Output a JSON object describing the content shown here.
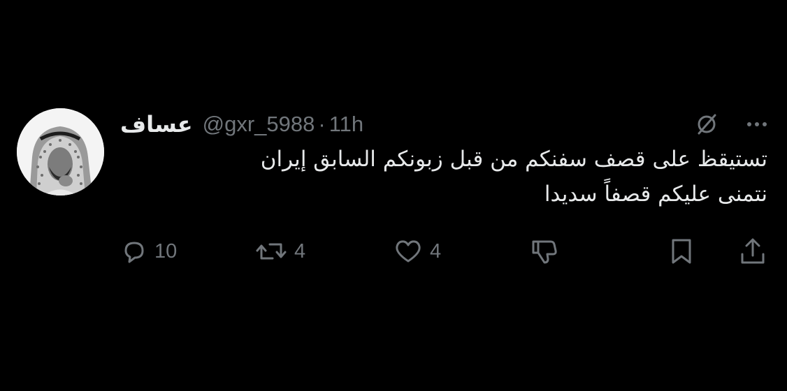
{
  "author": {
    "display_name": "عساف",
    "handle": "@gxr_5988",
    "separator": "·",
    "time": "11h",
    "avatar_icon": "profile-photo"
  },
  "tweet": {
    "text": "تستيقظ على قصف سفنكم من قبل زبونكم السابق إيران\nنتمنى عليكم  قصفاً سديدا"
  },
  "metrics": {
    "replies": "10",
    "reposts": "4",
    "likes": "4"
  },
  "icons": {
    "grok": "slash-circle-icon",
    "more": "more-icon",
    "reply": "reply-icon",
    "repost": "repost-icon",
    "like": "heart-icon",
    "dislike": "dislike-icon",
    "bookmark": "bookmark-icon",
    "share": "share-icon"
  },
  "colors": {
    "background": "#000000",
    "text": "#e7e9ea",
    "muted": "#71767b"
  }
}
